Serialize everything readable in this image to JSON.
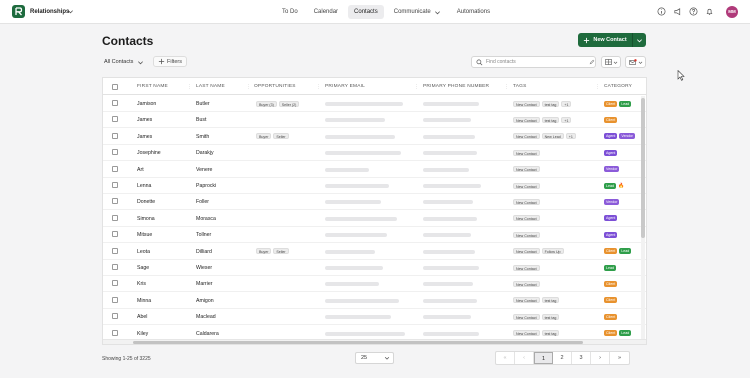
{
  "app": {
    "name": "Relationships",
    "avatar_initials": "MM"
  },
  "nav": {
    "todo": "To Do",
    "calendar": "Calendar",
    "contacts": "Contacts",
    "communicate": "Communicate",
    "automations": "Automations"
  },
  "page": {
    "title": "Contacts",
    "new_contact": "New Contact",
    "view_label": "All Contacts",
    "filters": "Filters",
    "search_placeholder": "Find contacts"
  },
  "table": {
    "headers": {
      "first_name": "FIRST NAME",
      "last_name": "LAST NAME",
      "opportunities": "OPPORTUNITIES",
      "email": "PRIMARY EMAIL",
      "phone": "PRIMARY PHONE NUMBER",
      "tags": "TAGS",
      "category": "CATEGORY"
    },
    "rows": [
      {
        "first": "Jamison",
        "last": "Butler",
        "opps": [
          "Buyer (3)",
          "Seller (2)"
        ],
        "tags": [
          "New Contact",
          "test tag",
          "+1"
        ],
        "cats": [
          "Client",
          "Lead"
        ]
      },
      {
        "first": "James",
        "last": "Bust",
        "opps": [],
        "tags": [
          "New Contact",
          "test tag",
          "+1"
        ],
        "cats": [
          "Client"
        ]
      },
      {
        "first": "James",
        "last": "Smith",
        "opps": [
          "Buyer",
          "Seller"
        ],
        "tags": [
          "New Contact",
          "New Lead",
          "+1"
        ],
        "cats": [
          "Agent",
          "Vendor"
        ]
      },
      {
        "first": "Josephine",
        "last": "Darakjy",
        "opps": [],
        "tags": [
          "New Contact"
        ],
        "cats": [
          "Agent"
        ]
      },
      {
        "first": "Art",
        "last": "Venere",
        "opps": [],
        "tags": [
          "New Contact"
        ],
        "cats": [
          "Vendor"
        ]
      },
      {
        "first": "Lenna",
        "last": "Paprocki",
        "opps": [],
        "tags": [
          "New Contact"
        ],
        "cats": [
          "Lead"
        ]
      },
      {
        "first": "Donette",
        "last": "Foller",
        "opps": [],
        "tags": [
          "New Contact"
        ],
        "cats": [
          "Vendor"
        ]
      },
      {
        "first": "Simona",
        "last": "Morasca",
        "opps": [],
        "tags": [
          "New Contact"
        ],
        "cats": [
          "Agent"
        ]
      },
      {
        "first": "Mitsue",
        "last": "Tollner",
        "opps": [],
        "tags": [
          "New Contact"
        ],
        "cats": [
          "Agent"
        ]
      },
      {
        "first": "Leota",
        "last": "Dilliard",
        "opps": [
          "Buyer",
          "Seller"
        ],
        "tags": [
          "New Contact",
          "Follow Up"
        ],
        "cats": [
          "Client",
          "Lead"
        ]
      },
      {
        "first": "Sage",
        "last": "Wieser",
        "opps": [],
        "tags": [
          "New Contact"
        ],
        "cats": [
          "Lead"
        ]
      },
      {
        "first": "Kris",
        "last": "Marrier",
        "opps": [],
        "tags": [
          "New Contact"
        ],
        "cats": [
          "Client"
        ]
      },
      {
        "first": "Minna",
        "last": "Amigon",
        "opps": [],
        "tags": [
          "New Contact",
          "test tag"
        ],
        "cats": [
          "Client"
        ]
      },
      {
        "first": "Abel",
        "last": "Maclead",
        "opps": [],
        "tags": [
          "New Contact",
          "test tag"
        ],
        "cats": [
          "Client"
        ]
      },
      {
        "first": "Kiley",
        "last": "Caldarera",
        "opps": [],
        "tags": [
          "New Contact",
          "test tag"
        ],
        "cats": [
          "Client",
          "Lead"
        ]
      }
    ]
  },
  "category_colors": {
    "Client": "#e8922e",
    "Lead": "#2f9e4a",
    "Agent": "#7c4fd6",
    "Vendor": "#8b5bd9"
  },
  "footer": {
    "showing": "Showing 1-25 of 3225",
    "page_size": "25",
    "pages": [
      "1",
      "2",
      "3"
    ],
    "current_page": "1"
  }
}
